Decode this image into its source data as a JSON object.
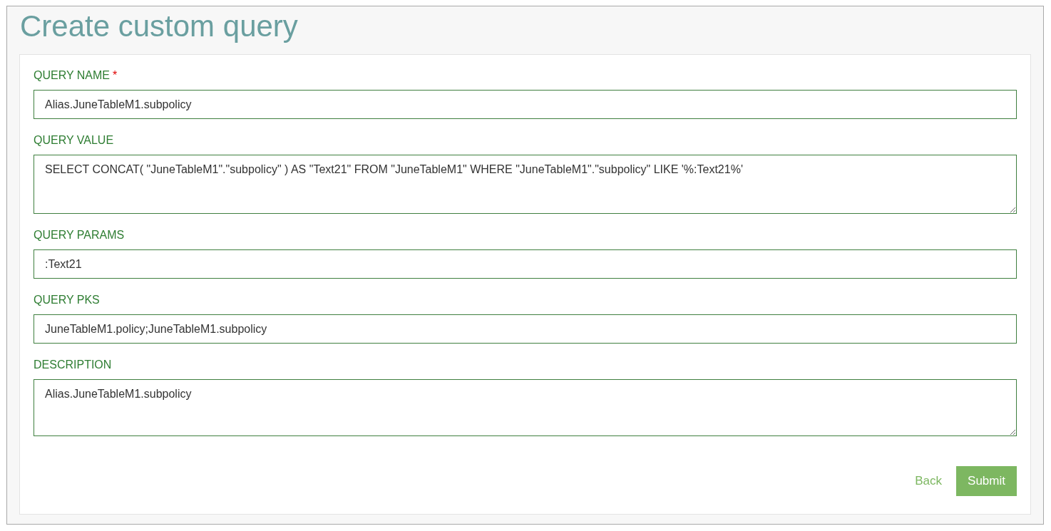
{
  "title": "Create custom query",
  "fields": [
    {
      "kind": "input",
      "label": "QUERY NAME",
      "required_mark": "*",
      "value": "Alias.JuneTableM1.subpolicy"
    },
    {
      "kind": "textarea",
      "label": "QUERY VALUE",
      "value": "SELECT CONCAT( \"JuneTableM1\".\"subpolicy\" ) AS \"Text21\" FROM \"JuneTableM1\" WHERE \"JuneTableM1\".\"subpolicy\" LIKE '%:Text21%'"
    },
    {
      "kind": "input",
      "label": "QUERY PARAMS",
      "value": ":Text21"
    },
    {
      "kind": "input",
      "label": "QUERY PKS",
      "value": "JuneTableM1.policy;JuneTableM1.subpolicy"
    },
    {
      "kind": "textarea",
      "label": "DESCRIPTION",
      "value": "Alias.JuneTableM1.subpolicy"
    }
  ],
  "buttons": [
    {
      "kind": "link",
      "label": "Back"
    },
    {
      "kind": "primary",
      "label": "Submit"
    }
  ]
}
